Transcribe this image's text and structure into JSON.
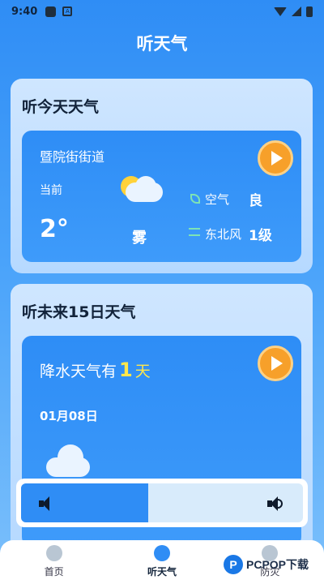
{
  "status_bar": {
    "time": "9:40",
    "notif_badge": "A"
  },
  "app": {
    "title": "听天气"
  },
  "today_card": {
    "heading": "听今天天气",
    "location": "暨院街街道",
    "now_label": "当前",
    "temperature": "2°",
    "weather": "雾",
    "weather_icon": "partly-cloudy-icon",
    "air_quality_label": "空气",
    "air_quality_value": "良",
    "wind_label": "东北风",
    "wind_value": "1级"
  },
  "forecast_card": {
    "heading": "听未来15日天气",
    "rain_prefix": "降水天气有",
    "rain_days": "1",
    "rain_unit": "天",
    "date": "01月08日",
    "weather_icon": "cloud-icon"
  },
  "volume": {
    "level": 0.45
  },
  "nav": {
    "items": [
      {
        "label": "首页",
        "icon": "location-icon"
      },
      {
        "label": "听天气",
        "icon": "speaker-icon"
      },
      {
        "label": "防灾",
        "icon": "shield-icon"
      }
    ],
    "active": 1
  },
  "watermark": {
    "text": "PCPOP下载"
  },
  "colors": {
    "accent": "#2f8df5",
    "play_button": "#f7a02a",
    "highlight": "#ffe74c"
  }
}
